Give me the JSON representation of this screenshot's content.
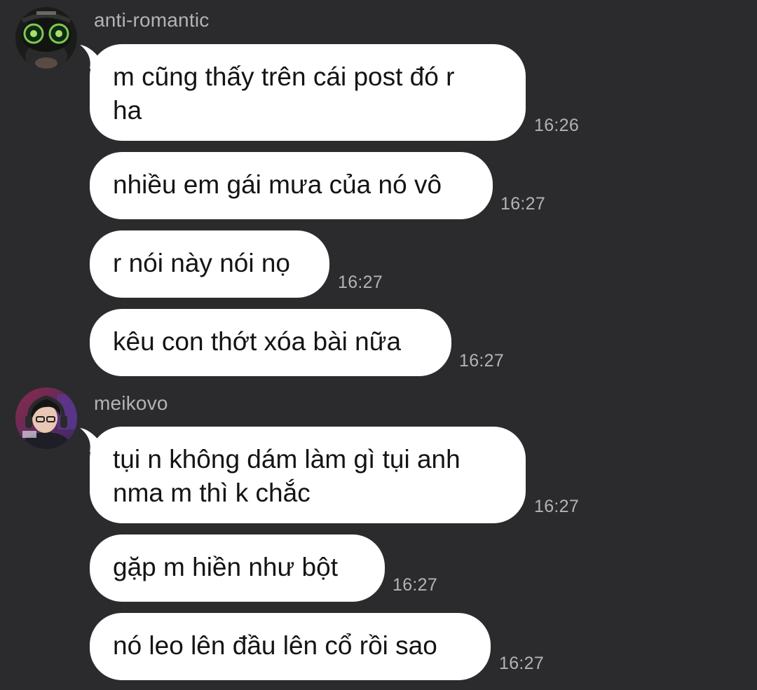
{
  "groups": [
    {
      "username": "anti-romantic",
      "avatar_icon": "masked-character-avatar",
      "messages": [
        {
          "lines": [
            "m cũng thấy trên cái post đó r",
            "ha"
          ],
          "time": "16:26"
        },
        {
          "lines": [
            "nhiều em gái mưa của nó vô"
          ],
          "time": "16:27"
        },
        {
          "lines": [
            "r nói này nói nọ"
          ],
          "time": "16:27"
        },
        {
          "lines": [
            "kêu con thớt xóa bài nữa"
          ],
          "time": "16:27"
        }
      ]
    },
    {
      "username": "meikovo",
      "avatar_icon": "gamer-headset-avatar",
      "messages": [
        {
          "lines": [
            "tụi n không dám làm gì tụi anh",
            "nma m thì k chắc"
          ],
          "time": "16:27"
        },
        {
          "lines": [
            "gặp m hiền như bột"
          ],
          "time": "16:27"
        },
        {
          "lines": [
            "nó leo lên đầu lên cổ rồi sao"
          ],
          "time": "16:27"
        }
      ]
    }
  ],
  "colors": {
    "background": "#2b2b2d",
    "bubble": "#ffffff",
    "meta_text": "#b3b3b6"
  }
}
